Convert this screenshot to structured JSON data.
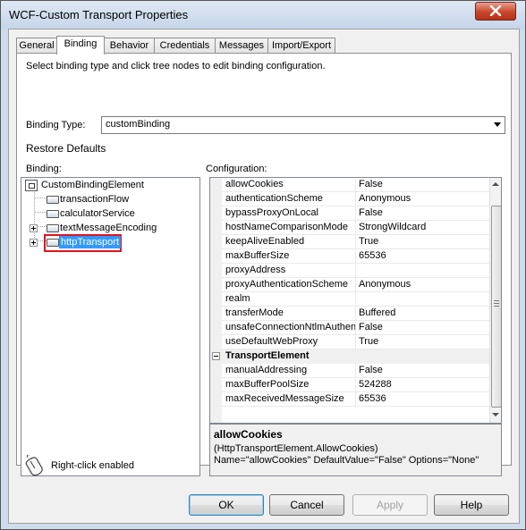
{
  "window": {
    "title": "WCF-Custom Transport Properties"
  },
  "tabs": [
    {
      "label": "General",
      "active": false
    },
    {
      "label": "Binding",
      "active": true
    },
    {
      "label": "Behavior",
      "active": false
    },
    {
      "label": "Credentials",
      "active": false
    },
    {
      "label": "Messages",
      "active": false
    },
    {
      "label": "Import/Export",
      "active": false
    }
  ],
  "binding_page": {
    "instruction": "Select binding type and click tree nodes to edit binding configuration.",
    "binding_type_label": "Binding Type:",
    "binding_type_value": "customBinding",
    "restore_defaults": "Restore Defaults",
    "binding_label": "Binding:",
    "configuration_label": "Configuration:"
  },
  "tree": {
    "root": "CustomBindingElement",
    "children": [
      "transactionFlow",
      "calculatorService",
      "textMessageEncoding",
      "httpTransport"
    ],
    "selected": "httpTransport"
  },
  "properties": {
    "rows": [
      {
        "name": "allowCookies",
        "value": "False"
      },
      {
        "name": "authenticationScheme",
        "value": "Anonymous"
      },
      {
        "name": "bypassProxyOnLocal",
        "value": "False"
      },
      {
        "name": "hostNameComparisonMode",
        "value": "StrongWildcard"
      },
      {
        "name": "keepAliveEnabled",
        "value": "True"
      },
      {
        "name": "maxBufferSize",
        "value": "65536"
      },
      {
        "name": "proxyAddress",
        "value": ""
      },
      {
        "name": "proxyAuthenticationScheme",
        "value": "Anonymous"
      },
      {
        "name": "realm",
        "value": ""
      },
      {
        "name": "transferMode",
        "value": "Buffered"
      },
      {
        "name": "unsafeConnectionNtlmAuthent",
        "value": "False"
      },
      {
        "name": "useDefaultWebProxy",
        "value": "True"
      }
    ],
    "category": "TransportElement",
    "category_rows": [
      {
        "name": "manualAddressing",
        "value": "False"
      },
      {
        "name": "maxBufferPoolSize",
        "value": "524288"
      },
      {
        "name": "maxReceivedMessageSize",
        "value": "65536"
      }
    ]
  },
  "description": {
    "title": "allowCookies",
    "line1": "(HttpTransportElement.AllowCookies)",
    "line2": "Name=\"allowCookies\" DefaultValue=\"False\" Options=\"None\""
  },
  "hint": {
    "text": "Right-click enabled",
    "icon": "mouse-icon"
  },
  "buttons": {
    "ok": "OK",
    "cancel": "Cancel",
    "apply": "Apply",
    "help": "Help"
  },
  "colors": {
    "selection": "#3399ff",
    "selection_border": "#e0141e",
    "title_bg": "#cfdcec",
    "close_button": "#c9462b"
  }
}
